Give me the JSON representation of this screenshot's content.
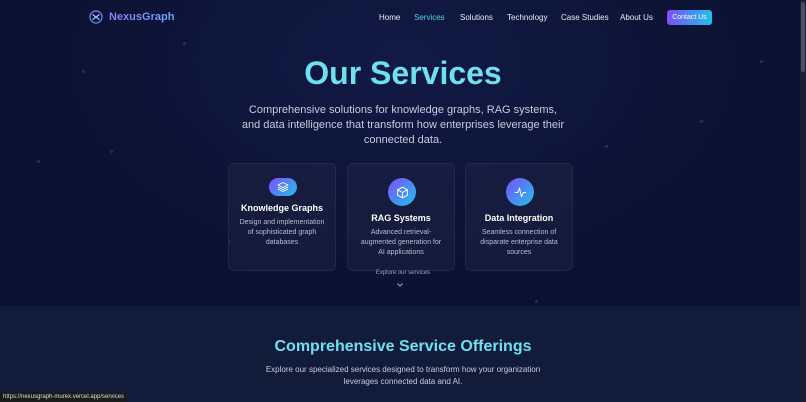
{
  "header": {
    "logo_text": "NexusGraph",
    "nav": [
      {
        "label": "Home",
        "active": false
      },
      {
        "label": "Services",
        "active": true
      },
      {
        "label": "Solutions",
        "active": false
      },
      {
        "label": "Technology",
        "active": false
      },
      {
        "label": "Case Studies",
        "active": false
      },
      {
        "label": "About Us",
        "active": false
      }
    ],
    "contact_label": "Contact Us"
  },
  "hero": {
    "title": "Our Services",
    "subtitle": "Comprehensive solutions for knowledge graphs, RAG systems, and data intelligence that transform how enterprises leverage their connected data."
  },
  "cards": [
    {
      "icon": "layers-icon",
      "title": "Knowledge Graphs",
      "desc": "Design and implementation of sophisticated graph databases"
    },
    {
      "icon": "cube-icon",
      "title": "RAG Systems",
      "desc": "Advanced retrieval-augmented generation for AI applications"
    },
    {
      "icon": "activity-icon",
      "title": "Data Integration",
      "desc": "Seamless connection of disparate enterprise data sources"
    }
  ],
  "explore_label": "Explore our services",
  "section2": {
    "title": "Comprehensive Service Offerings",
    "subtitle": "Explore our specialized services designed to transform how your organization leverages connected data and AI."
  },
  "status_url": "https://nexusgraph-murex.vercel.app/services",
  "colors": {
    "accent": "#6ee0ef",
    "active_nav": "#4fd1e8",
    "gradient_start": "#7c4dff",
    "gradient_end": "#22c1e8",
    "background": "#0b1130"
  }
}
